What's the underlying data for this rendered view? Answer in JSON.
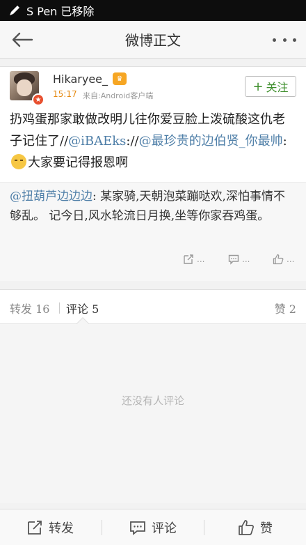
{
  "status_bar": {
    "text": "S Pen 已移除",
    "icon": "pen-icon"
  },
  "nav": {
    "title": "微博正文",
    "back_icon": "back-arrow-icon",
    "more_icon": "more-icon"
  },
  "post": {
    "username": "Hikaryee_",
    "member_badge_icon": "member-crown-icon",
    "verified_badge": "★",
    "time": "15:17",
    "source": "来自:Android客户端",
    "follow_label": "关注",
    "text_part1": "扔鸡蛋那家敢做改明儿往你爱豆脸上泼硫酸这仇老子记住了//",
    "mention1": "@iBAEks",
    "text_part2": "://",
    "mention2": "@最珍贵的边伯贤_你最帅",
    "text_part3": ":",
    "emoji": "smirk-emoji-icon",
    "text_part4": "大家要记得报恩啊"
  },
  "retweet": {
    "mention": "@扭葫芦边边边",
    "text": ": 某家骑,天朝泡菜蹦哒欢,深怕事情不够乱。 记今日,风水轮流日月换,坐等你家吞鸡蛋。",
    "actions": [
      {
        "icon": "share-icon",
        "label": "..."
      },
      {
        "icon": "comment-icon",
        "label": "..."
      },
      {
        "icon": "like-icon",
        "label": "..."
      }
    ]
  },
  "tabs": {
    "repost": "转发 16",
    "comments": "评论 5",
    "likes": "赞 2"
  },
  "comments": {
    "empty_text": "还没有人评论"
  },
  "bottom_bar": {
    "repost": "转发",
    "comment": "评论",
    "like": "赞"
  },
  "colors": {
    "link": "#4f7fa8",
    "follow_green": "#3f8f2d",
    "time_orange": "#e58a12"
  }
}
